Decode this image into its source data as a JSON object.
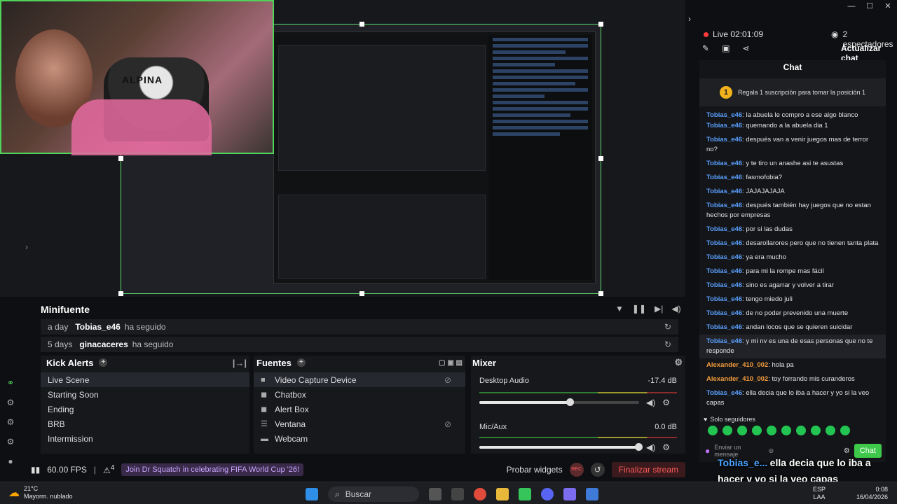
{
  "window": {
    "controls": [
      "—",
      "☐",
      "✕"
    ]
  },
  "preview": {
    "webcam_logo": "ALPINA",
    "nested_texts": [
      "Minifuente",
      "Kick Alerts",
      "Fuentes",
      "Mixer",
      "Live Scene",
      "Starting Soon",
      "Ending",
      "BRB",
      "Intermission",
      "Video Capture Device",
      "Chatbox",
      "Alert Box",
      "Ventana",
      "Webcam",
      "Desktop Audio",
      "Mic/Aux",
      "-17.4 dB",
      "0.0 dB",
      "60.00 FPS",
      "Probar widgets",
      "Finalizar stream",
      "Buscar"
    ]
  },
  "minifuente": {
    "title": "Minifuente",
    "events": [
      {
        "time": "a day",
        "user": "Tobias_e46",
        "action": "ha seguido"
      },
      {
        "time": "5 days",
        "user": "ginacaceres",
        "action": "ha seguido"
      }
    ]
  },
  "kick_alerts": {
    "title": "Kick Alerts",
    "scenes": [
      "Live Scene",
      "Starting Soon",
      "Ending",
      "BRB",
      "Intermission"
    ]
  },
  "fuentes": {
    "title": "Fuentes",
    "sources": [
      {
        "name": "Video Capture Device",
        "icon": "camera-icon"
      },
      {
        "name": "Chatbox",
        "icon": "chat-icon"
      },
      {
        "name": "Alert Box",
        "icon": "alert-icon"
      },
      {
        "name": "Ventana",
        "icon": "window-icon"
      },
      {
        "name": "Webcam",
        "icon": "folder-icon"
      }
    ]
  },
  "mixer": {
    "title": "Mixer",
    "channels": [
      {
        "name": "Desktop Audio",
        "db": "-17.4 dB",
        "level": 0.57
      },
      {
        "name": "Mic/Aux",
        "db": "0.0 dB",
        "level": 1.0
      }
    ]
  },
  "statusbar": {
    "fps": "60.00 FPS",
    "alerts_count": "4",
    "promo": "Join Dr Squatch in celebrating FIFA World Cup '26!",
    "test_widgets": "Probar widgets",
    "end_stream": "Finalizar stream",
    "rec": "REC"
  },
  "live": {
    "status": "Live 02:01:09",
    "viewers": "2 espectadores",
    "refresh_chat": "Actualizar chat"
  },
  "chat": {
    "title": "Chat",
    "gift_text": "Regala 1 suscripción para tomar la posición 1",
    "gift_rank": "1",
    "partial_top": "la abuela le compro a ese algo blanco",
    "messages": [
      {
        "user": "Tobias_e46",
        "text": "quemando a la abuela dia 1",
        "color": "#5aa0ff"
      },
      {
        "user": "Tobias_e46",
        "text": "después van a venir juegos mas de terror no?",
        "color": "#5aa0ff"
      },
      {
        "user": "Tobias_e46",
        "text": "y te tiro un anashe asi te asustas",
        "color": "#5aa0ff"
      },
      {
        "user": "Tobias_e46",
        "text": "fasmofobia?",
        "color": "#5aa0ff"
      },
      {
        "user": "Tobias_e46",
        "text": "JAJAJAJAJA",
        "color": "#5aa0ff"
      },
      {
        "user": "Tobias_e46",
        "text": "después también hay juegos que no estan hechos por empresas",
        "color": "#5aa0ff"
      },
      {
        "user": "Tobias_e46",
        "text": "por si las dudas",
        "color": "#5aa0ff"
      },
      {
        "user": "Tobias_e46",
        "text": "desarollarores pero que no tienen tanta plata",
        "color": "#5aa0ff"
      },
      {
        "user": "Tobias_e46",
        "text": "ya era mucho",
        "color": "#5aa0ff"
      },
      {
        "user": "Tobias_e46",
        "text": "para mi la rompe mas fácil",
        "color": "#5aa0ff"
      },
      {
        "user": "Tobias_e46",
        "text": "sino es agarrar y volver a tirar",
        "color": "#5aa0ff"
      },
      {
        "user": "Tobias_e46",
        "text": "tengo miedo juli",
        "color": "#5aa0ff"
      },
      {
        "user": "Tobias_e46",
        "text": "de no poder prevenido una muerte",
        "color": "#5aa0ff"
      },
      {
        "user": "Tobias_e46",
        "text": "andan locos que se quieren suicidar",
        "color": "#5aa0ff"
      },
      {
        "user": "Tobias_e46",
        "text": "y mi nv es una de esas personas que no te responde",
        "color": "#5aa0ff"
      },
      {
        "user": "Alexander_410_002",
        "text": "hola pa",
        "color": "#f39c3c"
      },
      {
        "user": "Alexander_410_002",
        "text": "toy forrando mis curanderos",
        "color": "#f39c3c"
      },
      {
        "user": "Tobias_e46",
        "text": "ella decia que lo iba a hacer y yo si la veo capas",
        "color": "#5aa0ff"
      }
    ],
    "followers_only": "Solo seguidores",
    "input_placeholder": "Enviar un mensaje",
    "send": "Chat"
  },
  "overlay": {
    "user": "Tobias_e...",
    "text": "ella decia que lo iba a hacer y yo si la veo capas"
  },
  "taskbar": {
    "weather_temp": "21°C",
    "weather_desc": "Mayorm. nublado",
    "search": "Buscar",
    "lang": "ESP",
    "region": "LAA",
    "time": "0:08",
    "date": "16/04/2026"
  }
}
